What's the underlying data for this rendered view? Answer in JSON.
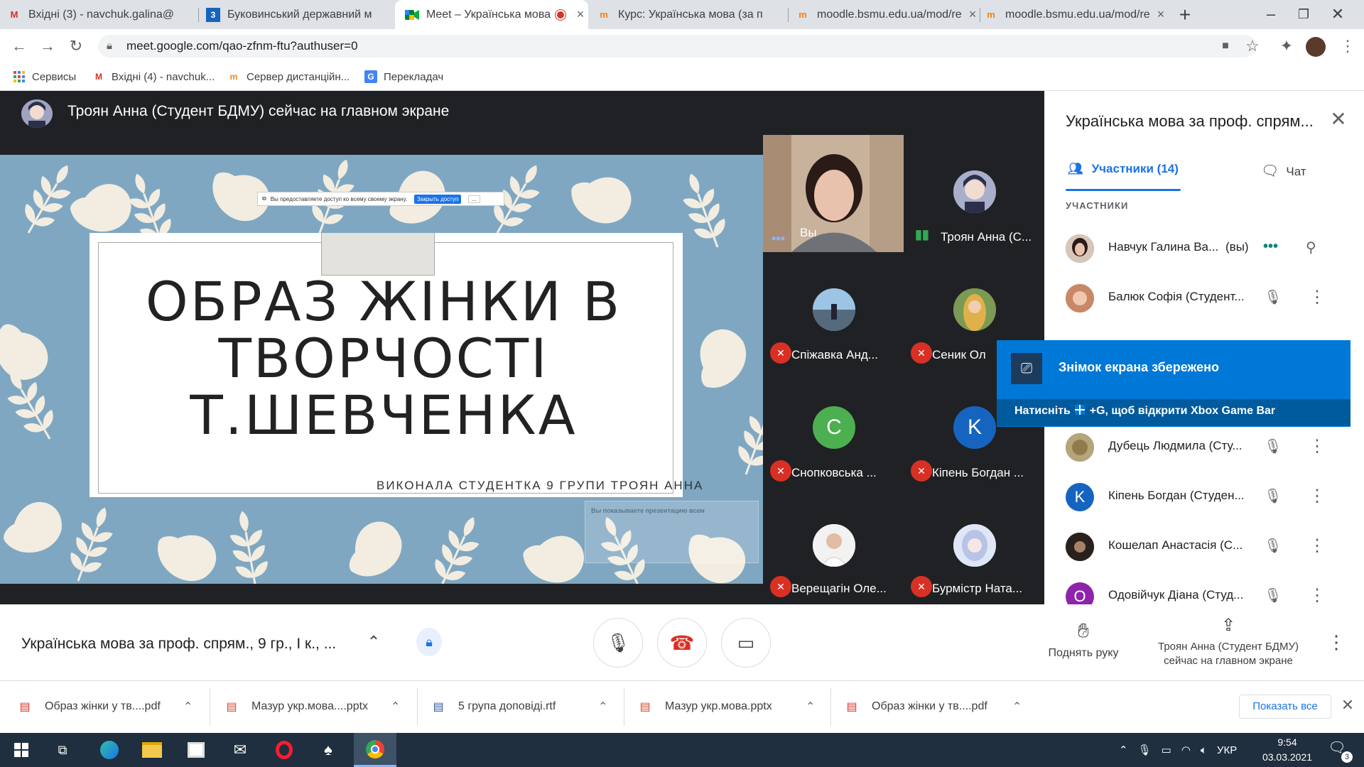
{
  "browser": {
    "tabs": [
      {
        "title": "Вхідні (3) - navchuk.galina@",
        "icon": "gmail-icon"
      },
      {
        "title": "Буковинський державний м",
        "icon": "bsmu-icon"
      },
      {
        "title": "Meet – Українська мова",
        "icon": "meet-icon",
        "active": true
      },
      {
        "title": "Курс: Українська мова (за п",
        "icon": "moodle-icon"
      },
      {
        "title": "moodle.bsmu.edu.ua/mod/re",
        "icon": "moodle-icon"
      },
      {
        "title": "moodle.bsmu.edu.ua/mod/re",
        "icon": "moodle-icon"
      }
    ],
    "new_tab": "+",
    "url": "meet.google.com/qao-zfnm-ftu?authuser=0",
    "bookmarks": [
      {
        "label": "Сервисы",
        "icon": "apps-grid-icon"
      },
      {
        "label": "Вхідні (4) - navchuk...",
        "icon": "gmail-icon"
      },
      {
        "label": "Сервер дистанційн...",
        "icon": "moodle-icon"
      },
      {
        "label": "Перекладач",
        "icon": "translate-icon"
      }
    ]
  },
  "meet": {
    "presenting_banner": "Троян Анна (Студент БДМУ) сейчас на главном экране",
    "slide": {
      "title": "ОБРАЗ ЖІНКИ В ТВОРЧОСТІ Т.ШЕВЧЕНКА",
      "footer": "ВИКОНАЛА СТУДЕНТКА  9 ГРУПИ ТРОЯН АННА",
      "sharing_notice": "Вы предоставляете доступ ко всему своему экрану.",
      "sharing_button": "Закрыть доступ",
      "sharing_minimize": "...",
      "ghost_notice": "Вы показываете презентацию всем"
    },
    "tiles": [
      {
        "name": "Вы",
        "avatar": ""
      },
      {
        "name": "Троян Анна (С...",
        "avatar": ""
      },
      {
        "name": "Спіжавка Анд...",
        "avatar": ""
      },
      {
        "name": "Сеник Ол",
        "avatar": ""
      },
      {
        "name": "Снопковська ...",
        "avatar": "С"
      },
      {
        "name": "Кіпень Богдан ...",
        "avatar": "K"
      },
      {
        "name": "Верещагін Оле...",
        "avatar": ""
      },
      {
        "name": "Бурмістр Ната...",
        "avatar": ""
      }
    ],
    "panel": {
      "title": "Українська мова за проф. спрям...",
      "participants_tab": "Участники (14)",
      "chat_tab": "Чат",
      "section_label": "УЧАСТНИКИ",
      "participants": [
        {
          "name": "Навчук Галина Ва...",
          "suffix": "(вы)",
          "avatar": ""
        },
        {
          "name": "Балюк Софія (Студент...",
          "avatar": ""
        },
        {
          "name": "Дубець Людмила (Сту...",
          "avatar": ""
        },
        {
          "name": "Кіпень Богдан (Студен...",
          "avatar": "K"
        },
        {
          "name": "Кошелап Анастасія (С...",
          "avatar": ""
        },
        {
          "name": "Одовійчук Діана (Студ...",
          "avatar": "О"
        }
      ]
    },
    "toast": {
      "title": "Знімок екрана збережено",
      "subtitle_before": "Натисніть",
      "subtitle_after": "+G, щоб відкрити Xbox Game Bar"
    },
    "bottom": {
      "meeting_title": "Українська мова за проф. спрям., 9 гр., І к., ...",
      "raise_hand": "Поднять руку",
      "presenting_label": "Троян Анна (Студент БДМУ) сейчас на главном экране"
    }
  },
  "downloads": {
    "items": [
      {
        "name": "Образ жінки у тв....pdf",
        "type": "pdf"
      },
      {
        "name": "Мазур укр.мова....pptx",
        "type": "pptx"
      },
      {
        "name": "5 група доповіді.rtf",
        "type": "rtf"
      },
      {
        "name": "Мазур укр.мова.pptx",
        "type": "pptx"
      },
      {
        "name": "Образ жінки у тв....pdf",
        "type": "pdf"
      }
    ],
    "show_all": "Показать все"
  },
  "taskbar": {
    "language": "УКР",
    "time": "9:54",
    "date": "03.03.2021",
    "notifications": "3"
  },
  "colors": {
    "accent": "#1a73e8",
    "meet_bg": "#202124",
    "mic_off": "#d93025",
    "toast": "#0078d7"
  }
}
